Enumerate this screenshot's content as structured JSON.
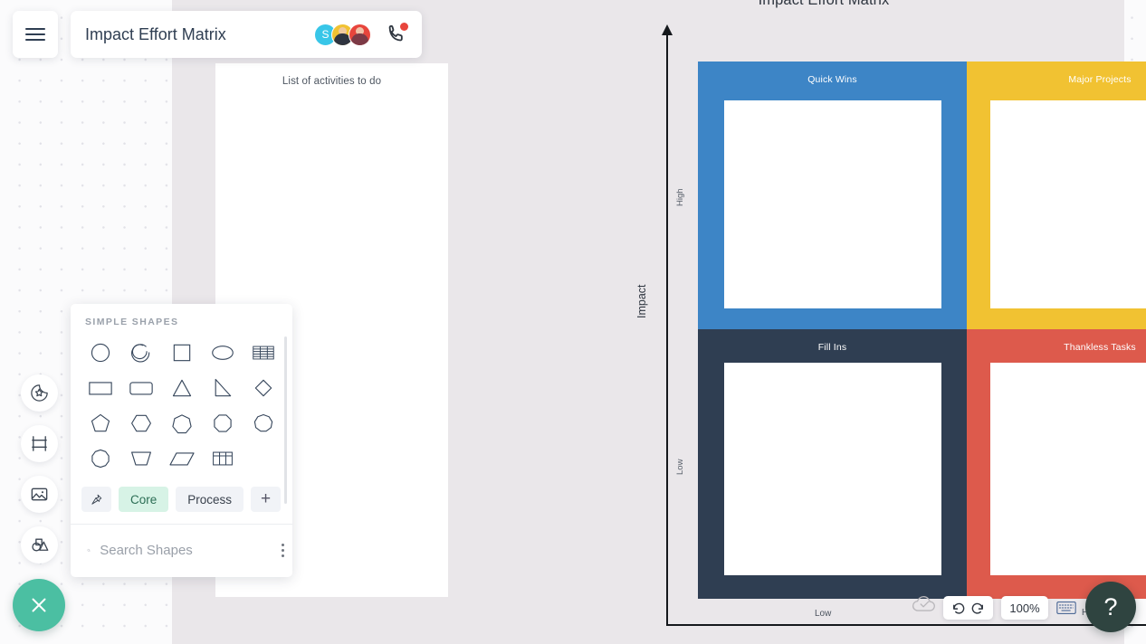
{
  "app": {
    "document_title": "Impact Effort Matrix",
    "menu_icon": "hamburger-icon",
    "call_icon": "phone-icon",
    "presence_badge_color": "#e8453c"
  },
  "collaborators": [
    {
      "initial": "S",
      "color": "#38c6e8",
      "type": "initial"
    },
    {
      "initial": "",
      "color": "#f1c232",
      "type": "photo",
      "head": "#f0c9a0",
      "body": "#2f3440"
    },
    {
      "initial": "",
      "color": "#e8453c",
      "type": "photo",
      "head": "#f0c2a8",
      "body": "#7c3a46"
    }
  ],
  "left_rail": [
    {
      "name": "sticker-icon",
      "label": "Stickers"
    },
    {
      "name": "frame-icon",
      "label": "Frames"
    },
    {
      "name": "image-icon",
      "label": "Images"
    },
    {
      "name": "shapes-icon",
      "label": "Shapes"
    }
  ],
  "fab": {
    "icon": "close-icon",
    "color": "#4bbfa2"
  },
  "shapes_panel": {
    "heading": "SIMPLE SHAPES",
    "shapes": [
      {
        "name": "circle-shape"
      },
      {
        "name": "arc-shape"
      },
      {
        "name": "square-shape"
      },
      {
        "name": "ellipse-shape"
      },
      {
        "name": "striped-table-shape"
      },
      {
        "name": "rectangle-shape"
      },
      {
        "name": "rounded-rectangle-shape"
      },
      {
        "name": "triangle-shape"
      },
      {
        "name": "right-triangle-shape"
      },
      {
        "name": "diamond-shape"
      },
      {
        "name": "pentagon-shape"
      },
      {
        "name": "hexagon-shape"
      },
      {
        "name": "heptagon-shape"
      },
      {
        "name": "octagon-shape"
      },
      {
        "name": "nonagon-shape"
      },
      {
        "name": "decagon-shape"
      },
      {
        "name": "trapezoid-shape"
      },
      {
        "name": "parallelogram-shape"
      },
      {
        "name": "table-grid-shape"
      }
    ],
    "tabs": {
      "pin_icon": "pin-icon",
      "core_label": "Core",
      "process_label": "Process",
      "add_label": "+",
      "active": "Core",
      "active_color": "#d7f3e6"
    },
    "search": {
      "placeholder": "Search Shapes",
      "value": "",
      "icon": "search-icon",
      "overflow_icon": "kebab-menu-icon"
    }
  },
  "canvas": {
    "sheet_label": "List of activities to do"
  },
  "chart_data": {
    "type": "matrix",
    "title": "Impact Effort Matrix",
    "xlabel": "",
    "ylabel": "Impact",
    "x_ticks": [
      "Low",
      "High"
    ],
    "y_ticks": [
      "Low",
      "High"
    ],
    "quadrants": [
      {
        "id": "quick-wins",
        "label": "Quick Wins",
        "color": "#3d85c6",
        "impact": "High",
        "effort": "Low",
        "note": ""
      },
      {
        "id": "major-projects",
        "label": "Major Projects",
        "color": "#f1c232",
        "impact": "High",
        "effort": "High",
        "note": ""
      },
      {
        "id": "fill-ins",
        "label": "Fill Ins",
        "color": "#2f3e52",
        "impact": "Low",
        "effort": "Low",
        "note": ""
      },
      {
        "id": "thankless-tasks",
        "label": "Thankless Tasks",
        "color": "#dd5a4c",
        "impact": "Low",
        "effort": "High",
        "note": ""
      }
    ]
  },
  "bottom_toolbar": {
    "sync_icon": "cloud-check-icon",
    "undo_icon": "undo-icon",
    "redo_icon": "redo-icon",
    "zoom_level": "100%",
    "keyboard_icon": "keyboard-icon",
    "help_label": "?"
  }
}
